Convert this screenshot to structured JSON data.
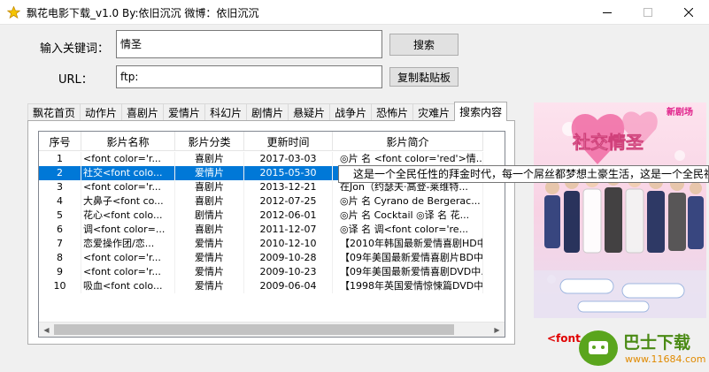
{
  "window": {
    "title": "飘花电影下载_v1.0  By:依旧沉沉  微博：依旧沉沉",
    "icon": "star-icon"
  },
  "search": {
    "keyword_label": "输入关键词：",
    "keyword_value": "情圣",
    "search_button": "搜索",
    "url_label": "URL：",
    "url_value": "ftp:",
    "copy_button": "复制黏贴板"
  },
  "tabs": [
    {
      "label": "飘花首页",
      "active": false
    },
    {
      "label": "动作片",
      "active": false
    },
    {
      "label": "喜剧片",
      "active": false
    },
    {
      "label": "爱情片",
      "active": false
    },
    {
      "label": "科幻片",
      "active": false
    },
    {
      "label": "剧情片",
      "active": false
    },
    {
      "label": "悬疑片",
      "active": false
    },
    {
      "label": "战争片",
      "active": false
    },
    {
      "label": "恐怖片",
      "active": false
    },
    {
      "label": "灾难片",
      "active": false
    },
    {
      "label": "搜索内容",
      "active": true
    }
  ],
  "table": {
    "columns": [
      "序号",
      "影片名称",
      "影片分类",
      "更新时间",
      "影片简介"
    ],
    "selected_index": 1,
    "rows": [
      {
        "num": "1",
        "name": "<font color='r...",
        "category": "喜剧片",
        "date": "2017-03-03",
        "desc": "◎片 名 <font color='red'>情..."
      },
      {
        "num": "2",
        "name": "社交<font colo...",
        "category": "爱情片",
        "date": "2015-05-30",
        "desc": ""
      },
      {
        "num": "3",
        "name": "<font color='r...",
        "category": "喜剧片",
        "date": "2013-12-21",
        "desc": "在Jon（约瑟夫·高登-莱维特..."
      },
      {
        "num": "4",
        "name": "大鼻子<font co...",
        "category": "喜剧片",
        "date": "2012-07-25",
        "desc": "◎片 名 Cyrano de Bergerac..."
      },
      {
        "num": "5",
        "name": "花心<font colo...",
        "category": "剧情片",
        "date": "2012-06-01",
        "desc": "◎片 名 Cocktail ◎译 名 花..."
      },
      {
        "num": "6",
        "name": "调<font color=...",
        "category": "喜剧片",
        "date": "2011-12-07",
        "desc": "◎译 名 调<font color='re..."
      },
      {
        "num": "7",
        "name": "恋爱操作团/恋...",
        "category": "爱情片",
        "date": "2010-12-10",
        "desc": "【2010年韩国最新爱情喜剧HD中..."
      },
      {
        "num": "8",
        "name": "<font color='r...",
        "category": "爱情片",
        "date": "2009-10-28",
        "desc": "【09年美国最新爱情喜剧片BD中..."
      },
      {
        "num": "9",
        "name": "<font color='r...",
        "category": "爱情片",
        "date": "2009-10-23",
        "desc": "【09年美国最新爱情喜剧DVD中..."
      },
      {
        "num": "10",
        "name": "吸血<font colo...",
        "category": "爱情片",
        "date": "2009-06-04",
        "desc": "【1998年英国爱情惊悚篇DVD中..."
      }
    ]
  },
  "tooltip": "这是一个全民任性的拜金时代，每一个屌丝都梦想土豪生活，这是一个全民社",
  "poster": {
    "title": "社交情圣",
    "badge": "新剧场"
  },
  "preview_text": "<font",
  "watermark": {
    "title": "巴士下载",
    "url": "www.11684.com"
  },
  "colors": {
    "selection": "#0078d7",
    "red_text": "#e00000"
  }
}
